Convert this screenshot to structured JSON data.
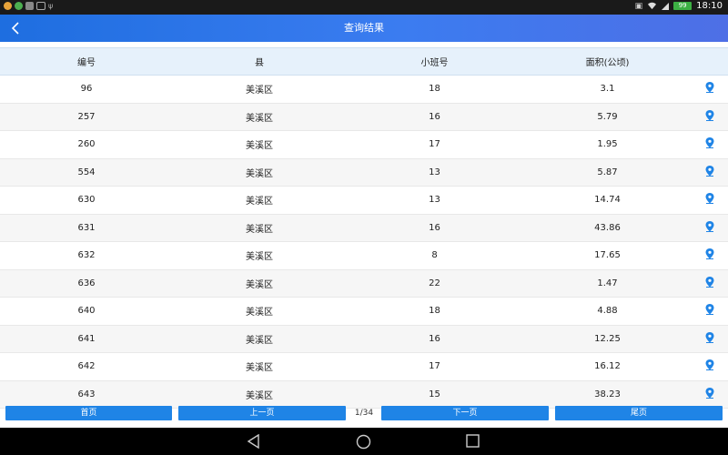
{
  "status": {
    "time": "18:10",
    "battery": "99"
  },
  "header": {
    "title": "查询结果"
  },
  "table": {
    "columns": [
      "编号",
      "县",
      "小班号",
      "面积(公顷)"
    ],
    "rows": [
      {
        "id": "96",
        "county": "美溪区",
        "subcompartment": "18",
        "area": "3.1"
      },
      {
        "id": "257",
        "county": "美溪区",
        "subcompartment": "16",
        "area": "5.79"
      },
      {
        "id": "260",
        "county": "美溪区",
        "subcompartment": "17",
        "area": "1.95"
      },
      {
        "id": "554",
        "county": "美溪区",
        "subcompartment": "13",
        "area": "5.87"
      },
      {
        "id": "630",
        "county": "美溪区",
        "subcompartment": "13",
        "area": "14.74"
      },
      {
        "id": "631",
        "county": "美溪区",
        "subcompartment": "16",
        "area": "43.86"
      },
      {
        "id": "632",
        "county": "美溪区",
        "subcompartment": "8",
        "area": "17.65"
      },
      {
        "id": "636",
        "county": "美溪区",
        "subcompartment": "22",
        "area": "1.47"
      },
      {
        "id": "640",
        "county": "美溪区",
        "subcompartment": "18",
        "area": "4.88"
      },
      {
        "id": "641",
        "county": "美溪区",
        "subcompartment": "16",
        "area": "12.25"
      },
      {
        "id": "642",
        "county": "美溪区",
        "subcompartment": "17",
        "area": "16.12"
      },
      {
        "id": "643",
        "county": "美溪区",
        "subcompartment": "15",
        "area": "38.23"
      }
    ],
    "row_icon": "location-pin-icon"
  },
  "pagination": {
    "first_label": "首页",
    "prev_label": "上一页",
    "page_indicator": "1/34",
    "next_label": "下一页",
    "last_label": "尾页"
  },
  "colors": {
    "primary": "#1f84e6",
    "header_bg": "#e6f1fb",
    "title_gradient_start": "#1e6ee0",
    "title_gradient_end": "#4e6fe6"
  }
}
